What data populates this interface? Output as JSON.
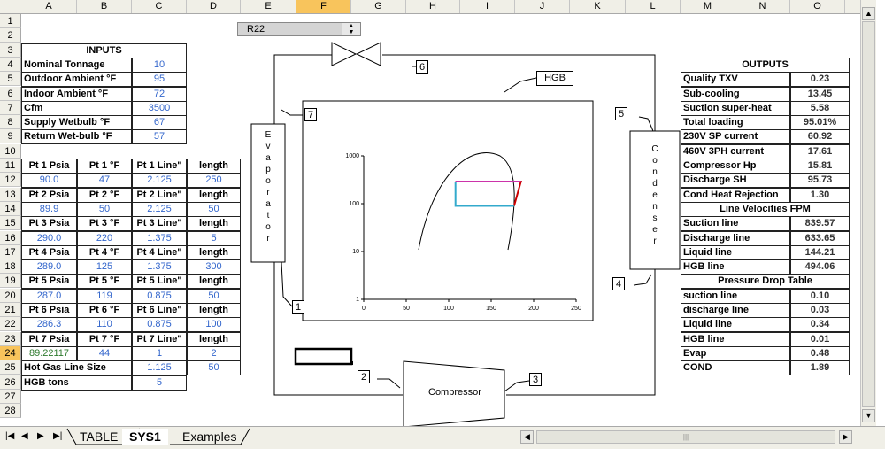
{
  "columns": [
    "A",
    "B",
    "C",
    "D",
    "E",
    "F",
    "G",
    "H",
    "I",
    "J",
    "K",
    "L",
    "M",
    "N",
    "O"
  ],
  "selected_column": "F",
  "rows": [
    "1",
    "2",
    "3",
    "4",
    "5",
    "6",
    "7",
    "8",
    "9",
    "10",
    "11",
    "12",
    "13",
    "14",
    "15",
    "16",
    "17",
    "18",
    "19",
    "20",
    "21",
    "22",
    "23",
    "24",
    "25",
    "26",
    "27",
    "28"
  ],
  "selected_row": "24",
  "refrigerant": "R22",
  "inputs": {
    "title": "INPUTS",
    "items": [
      {
        "label": "Nominal Tonnage",
        "value": "10"
      },
      {
        "label": "Outdoor Ambient °F",
        "value": "95"
      },
      {
        "label": "Indoor Ambient °F",
        "value": "72"
      },
      {
        "label": "Cfm",
        "value": "3500"
      },
      {
        "label": "Supply Wetbulb °F",
        "value": "67"
      },
      {
        "label": "Return Wet-bulb °F",
        "value": "57"
      }
    ]
  },
  "points": [
    {
      "h": [
        "Pt 1 Psia",
        "Pt 1 °F",
        "Pt 1 Line\"",
        "length"
      ],
      "v": [
        "90.0",
        "47",
        "2.125",
        "250"
      ]
    },
    {
      "h": [
        "Pt 2 Psia",
        "Pt 2 °F",
        "Pt 2 Line\"",
        "length"
      ],
      "v": [
        "89.9",
        "50",
        "2.125",
        "50"
      ]
    },
    {
      "h": [
        "Pt 3 Psia",
        "Pt 3 °F",
        "Pt 3 Line\"",
        "length"
      ],
      "v": [
        "290.0",
        "220",
        "1.375",
        "5"
      ]
    },
    {
      "h": [
        "Pt 4 Psia",
        "Pt 4 °F",
        "Pt 4 Line\"",
        "length"
      ],
      "v": [
        "289.0",
        "125",
        "1.375",
        "300"
      ]
    },
    {
      "h": [
        "Pt 5 Psia",
        "Pt 5 °F",
        "Pt 5 Line\"",
        "length"
      ],
      "v": [
        "287.0",
        "119",
        "0.875",
        "50"
      ]
    },
    {
      "h": [
        "Pt 6 Psia",
        "Pt 6 °F",
        "Pt 6 Line\"",
        "length"
      ],
      "v": [
        "286.3",
        "110",
        "0.875",
        "100"
      ]
    },
    {
      "h": [
        "Pt 7 Psia",
        "Pt 7 °F",
        "Pt 7 Line\"",
        "length"
      ],
      "v": [
        "89.22117",
        "44",
        "1",
        "2"
      ]
    }
  ],
  "hot_gas": {
    "label": "Hot Gas Line Size",
    "v1": "1.125",
    "v2": "50"
  },
  "hgb_tons": {
    "label": "HGB tons",
    "value": "5"
  },
  "outputs": {
    "title": "OUTPUTS",
    "items": [
      {
        "label": "Quality TXV",
        "value": "0.23"
      },
      {
        "label": "Sub-cooling",
        "value": "13.45"
      },
      {
        "label": "Suction super-heat",
        "value": "5.58"
      },
      {
        "label": "Total loading",
        "value": "95.01%"
      },
      {
        "label": "230V SP current",
        "value": "60.92"
      },
      {
        "label": "460V 3PH current",
        "value": "17.61"
      },
      {
        "label": "Compressor Hp",
        "value": "15.81"
      },
      {
        "label": "Discharge SH",
        "value": "95.73"
      },
      {
        "label": "Cond Heat Rejection",
        "value": "1.30"
      }
    ],
    "velocities_title": "Line Velocities FPM",
    "velocities": [
      {
        "label": "Suction line",
        "value": "839.57"
      },
      {
        "label": "Discharge line",
        "value": "633.65"
      },
      {
        "label": "Liquid line",
        "value": "144.21"
      },
      {
        "label": "HGB line",
        "value": "494.06"
      }
    ],
    "pressure_title": "Pressure Drop Table",
    "pressure": [
      {
        "label": "suction line",
        "value": "0.10"
      },
      {
        "label": "discharge line",
        "value": "0.03"
      },
      {
        "label": "Liquid line",
        "value": "0.34"
      },
      {
        "label": "HGB line",
        "value": "0.01"
      },
      {
        "label": "Evap",
        "value": "0.48"
      },
      {
        "label": "COND",
        "value": "1.89"
      }
    ]
  },
  "diagram": {
    "evaporator_letters": [
      "E",
      "v",
      "a",
      "p",
      "o",
      "r",
      "a",
      "t",
      "o",
      "r"
    ],
    "condenser_letters": [
      "C",
      "o",
      "n",
      "d",
      "e",
      "n",
      "s",
      "e",
      "r"
    ],
    "compressor": "Compressor",
    "hgb": "HGB",
    "numbers": [
      "1",
      "2",
      "3",
      "4",
      "5",
      "6",
      "7"
    ]
  },
  "chart_data": {
    "type": "line",
    "y_scale": "log",
    "ylim": [
      1,
      1000
    ],
    "xlim": [
      0,
      250
    ],
    "x_ticks": [
      "0",
      "50",
      "100",
      "150",
      "200",
      "250"
    ],
    "y_ticks": [
      "1",
      "10",
      "100",
      "1000"
    ],
    "series": [
      {
        "color": "#cc0000",
        "points": [
          [
            108,
            290
          ],
          [
            185,
            290
          ],
          [
            177,
            90
          ]
        ]
      },
      {
        "color": "#cc33aa",
        "points": [
          [
            108,
            290
          ],
          [
            185,
            290
          ]
        ]
      },
      {
        "color": "#33aacc",
        "points": [
          [
            108,
            290
          ],
          [
            108,
            90
          ],
          [
            177,
            90
          ]
        ]
      }
    ]
  },
  "sheet_tabs": [
    {
      "label": "TABLE",
      "active": false
    },
    {
      "label": "SYS1",
      "active": true
    },
    {
      "label": "Examples",
      "active": false
    }
  ]
}
